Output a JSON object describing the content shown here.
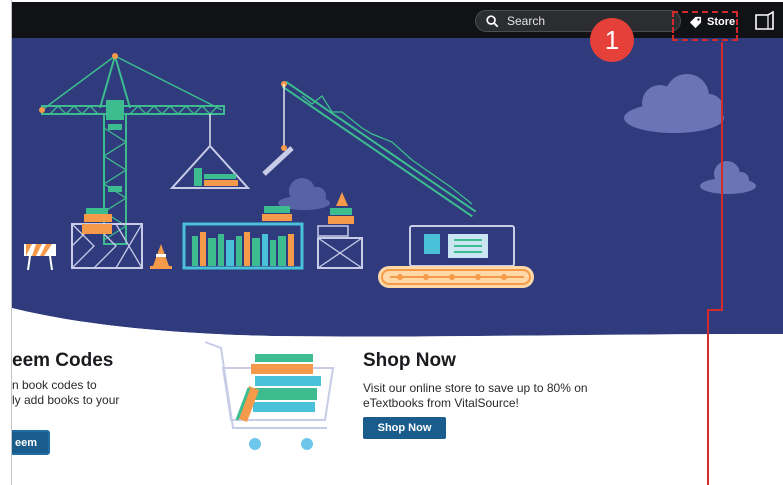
{
  "topbar": {
    "search_label": "Search",
    "store_label": "Store",
    "icons": [
      "search-icon",
      "tag-icon",
      "reader-icon",
      "kebab-menu-icon"
    ]
  },
  "annotation": {
    "step_number": "1",
    "color": "#e5403a"
  },
  "redeem": {
    "title": "eem Codes",
    "line1": "n book codes to",
    "line2": "ly add books to your",
    "button_label": "eem"
  },
  "shop": {
    "title": "Shop Now",
    "description": "Visit our online store to save up to 80% on eTextbooks from VitalSource!",
    "button_label": "Shop Now"
  },
  "colors": {
    "hero_bg": "#2f3b7c",
    "crane": "#3dbd8f",
    "accent_orange": "#f59a4a",
    "button": "#1a5d8d",
    "topbar": "#111215"
  }
}
